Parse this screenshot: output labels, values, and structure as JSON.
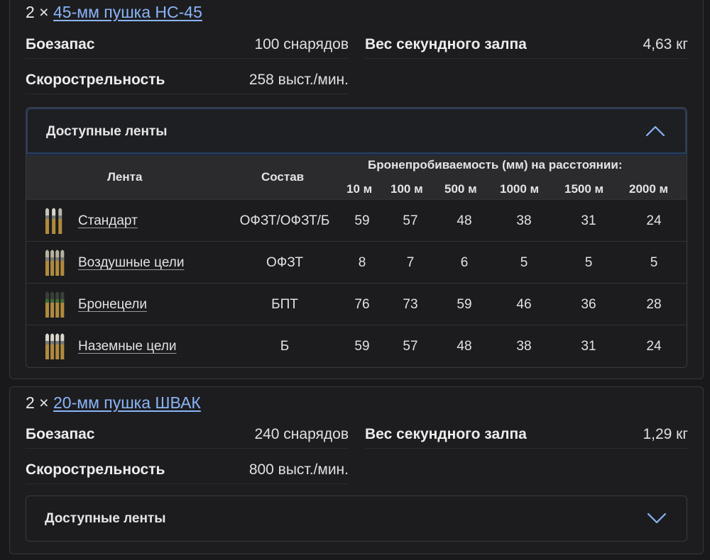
{
  "weapons": [
    {
      "count": "2 ×",
      "name": "45-мм пушка НС-45",
      "ammo_label": "Боезапас",
      "ammo_value": "100 снарядов",
      "salvo_label": "Вес секундного залпа",
      "salvo_value": "4,63 кг",
      "rof_label": "Скорострельность",
      "rof_value": "258 выст./мин.",
      "belts": {
        "title": "Доступные ленты",
        "expanded": true,
        "headers": {
          "belt": "Лента",
          "composition": "Состав",
          "penetration": "Бронепробиваемость (мм) на расстоянии:",
          "distances": [
            "10 м",
            "100 м",
            "500 м",
            "1000 м",
            "1500 м",
            "2000 м"
          ]
        },
        "rows": [
          {
            "name": "Стандарт",
            "composition": "ОФЗТ/ОФЗТ/Б",
            "values": [
              "59",
              "57",
              "48",
              "38",
              "31",
              "24"
            ],
            "icon": "ammo-belt-icon",
            "tips": [
              "#c8c4b8",
              "#d9d6cc",
              "#b9b5a8"
            ]
          },
          {
            "name": "Воздушные цели",
            "composition": "ОФЗТ",
            "values": [
              "8",
              "7",
              "6",
              "5",
              "5",
              "5"
            ],
            "icon": "ammo-belt-icon",
            "tips": [
              "#b5b2a0",
              "#b5b2a0",
              "#b5b2a0",
              "#b5b2a0"
            ]
          },
          {
            "name": "Бронецели",
            "composition": "БПТ",
            "values": [
              "76",
              "73",
              "59",
              "46",
              "36",
              "28"
            ],
            "icon": "ammo-belt-icon",
            "tips": [
              "#3a3f3a",
              "#3a3f3a",
              "#3a3f3a",
              "#3a3f3a"
            ]
          },
          {
            "name": "Наземные цели",
            "composition": "Б",
            "values": [
              "59",
              "57",
              "48",
              "38",
              "31",
              "24"
            ],
            "icon": "ammo-belt-icon",
            "tips": [
              "#d8d5cc",
              "#d8d5cc",
              "#d8d5cc",
              "#d8d5cc"
            ]
          }
        ]
      }
    },
    {
      "count": "2 ×",
      "name": "20-мм пушка ШВАК",
      "ammo_label": "Боезапас",
      "ammo_value": "240 снарядов",
      "salvo_label": "Вес секундного залпа",
      "salvo_value": "1,29 кг",
      "rof_label": "Скорострельность",
      "rof_value": "800 выст./мин.",
      "belts": {
        "title": "Доступные ленты",
        "expanded": false
      }
    }
  ],
  "colors": {
    "link": "#8ab4f8",
    "chevron": "#8ab4f8",
    "background": "#19191b",
    "card": "#1d1d1f",
    "table_header": "#2b2b2e"
  }
}
